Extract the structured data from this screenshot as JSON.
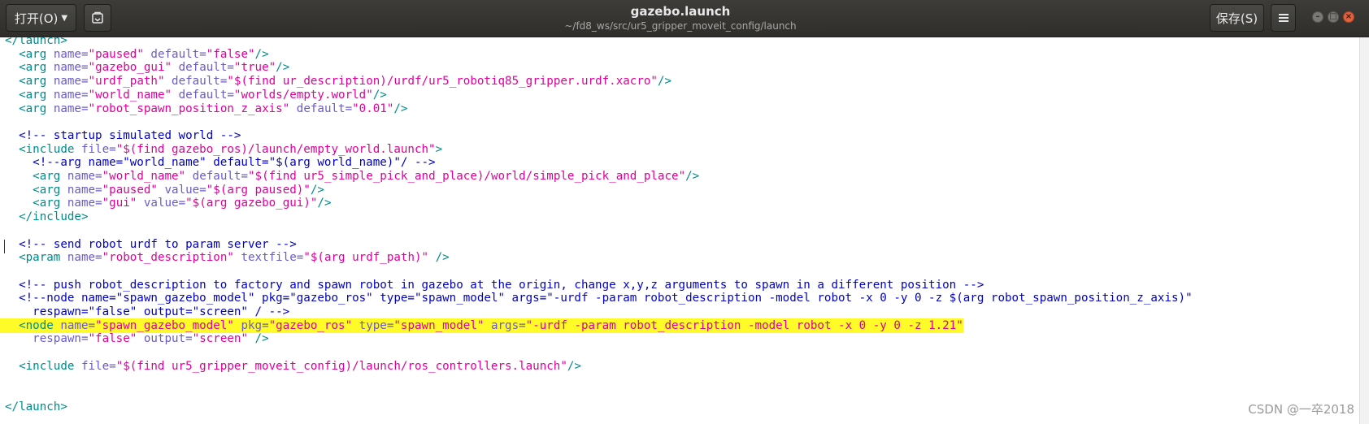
{
  "window": {
    "title": "gazebo.launch",
    "subtitle": "~/fd8_ws/src/ur5_gripper_moveit_config/launch",
    "open_label": "打开(O)",
    "save_label": "保存(S)"
  },
  "colors": {
    "tag": "#008b8b",
    "attr": "#6a5acd",
    "string": "#e0009a",
    "comment": "#0000c8",
    "highlight": "#fffb29"
  },
  "editor": {
    "lines": [
      [
        [
          "tag",
          "</launch>"
        ]
      ],
      [
        [
          "plain",
          "  "
        ],
        [
          "tag",
          "<arg "
        ],
        [
          "attr",
          "name="
        ],
        [
          "string",
          "\"paused\""
        ],
        [
          "attr",
          " default="
        ],
        [
          "string",
          "\"false\""
        ],
        [
          "tag",
          "/>"
        ]
      ],
      [
        [
          "plain",
          "  "
        ],
        [
          "tag",
          "<arg "
        ],
        [
          "attr",
          "name="
        ],
        [
          "string",
          "\"gazebo_gui\""
        ],
        [
          "attr",
          " default="
        ],
        [
          "string",
          "\"true\""
        ],
        [
          "tag",
          "/>"
        ]
      ],
      [
        [
          "plain",
          "  "
        ],
        [
          "tag",
          "<arg "
        ],
        [
          "attr",
          "name="
        ],
        [
          "string",
          "\"urdf_path\""
        ],
        [
          "attr",
          " default="
        ],
        [
          "string",
          "\"$(find ur_description)/urdf/ur5_robotiq85_gripper.urdf.xacro\""
        ],
        [
          "tag",
          "/>"
        ]
      ],
      [
        [
          "plain",
          "  "
        ],
        [
          "tag",
          "<arg "
        ],
        [
          "attr",
          "name="
        ],
        [
          "string",
          "\"world_name\""
        ],
        [
          "attr",
          " default="
        ],
        [
          "string",
          "\"worlds/empty.world\""
        ],
        [
          "tag",
          "/>"
        ]
      ],
      [
        [
          "plain",
          "  "
        ],
        [
          "tag",
          "<arg "
        ],
        [
          "attr",
          "name="
        ],
        [
          "string",
          "\"robot_spawn_position_z_axis\""
        ],
        [
          "attr",
          " default="
        ],
        [
          "string",
          "\"0.01\""
        ],
        [
          "tag",
          "/>"
        ]
      ],
      [],
      [
        [
          "plain",
          "  "
        ],
        [
          "comment",
          "<!-- startup simulated world -->"
        ]
      ],
      [
        [
          "plain",
          "  "
        ],
        [
          "tag",
          "<include "
        ],
        [
          "attr",
          "file="
        ],
        [
          "string",
          "\"$(find gazebo_ros)/launch/empty_world.launch\""
        ],
        [
          "tag",
          ">"
        ]
      ],
      [
        [
          "plain",
          "    "
        ],
        [
          "comment",
          "<!--arg name=\"world_name\" default=\"$(arg world_name)\"/ -->"
        ]
      ],
      [
        [
          "plain",
          "    "
        ],
        [
          "tag",
          "<arg "
        ],
        [
          "attr",
          "name="
        ],
        [
          "string",
          "\"world_name\""
        ],
        [
          "attr",
          " default="
        ],
        [
          "string",
          "\"$(find ur5_simple_pick_and_place)/world/simple_pick_and_place\""
        ],
        [
          "tag",
          "/>"
        ]
      ],
      [
        [
          "plain",
          "    "
        ],
        [
          "tag",
          "<arg "
        ],
        [
          "attr",
          "name="
        ],
        [
          "string",
          "\"paused\""
        ],
        [
          "attr",
          " value="
        ],
        [
          "string",
          "\"$(arg paused)\""
        ],
        [
          "tag",
          "/>"
        ]
      ],
      [
        [
          "plain",
          "    "
        ],
        [
          "tag",
          "<arg "
        ],
        [
          "attr",
          "name="
        ],
        [
          "string",
          "\"gui\""
        ],
        [
          "attr",
          " value="
        ],
        [
          "string",
          "\"$(arg gazebo_gui)\""
        ],
        [
          "tag",
          "/>"
        ]
      ],
      [
        [
          "plain",
          "  "
        ],
        [
          "tag",
          "</include>"
        ]
      ],
      [],
      [
        [
          "plain",
          "  "
        ],
        [
          "comment",
          "<!-- send robot urdf to param server -->"
        ]
      ],
      [
        [
          "plain",
          "  "
        ],
        [
          "tag",
          "<param "
        ],
        [
          "attr",
          "name="
        ],
        [
          "string",
          "\"robot_description\""
        ],
        [
          "attr",
          " textfile="
        ],
        [
          "string",
          "\"$(arg urdf_path)\""
        ],
        [
          "tag",
          " />"
        ]
      ],
      [],
      [
        [
          "plain",
          "  "
        ],
        [
          "comment",
          "<!-- push robot_description to factory and spawn robot in gazebo at the origin, change x,y,z arguments to spawn in a different position -->"
        ]
      ],
      [
        [
          "plain",
          "  "
        ],
        [
          "comment",
          "<!--node name=\"spawn_gazebo_model\" pkg=\"gazebo_ros\" type=\"spawn_model\" args=\"-urdf -param robot_description -model robot -x 0 -y 0 -z $(arg robot_spawn_position_z_axis)\""
        ]
      ],
      [
        [
          "plain",
          "    "
        ],
        [
          "comment",
          "respawn=\"false\" output=\"screen\" / -->"
        ]
      ],
      [
        [
          "plain",
          "  "
        ],
        [
          "tag",
          "<node "
        ],
        [
          "attr",
          "name="
        ],
        [
          "string",
          "\"spawn_gazebo_model\""
        ],
        [
          "attr",
          " pkg="
        ],
        [
          "string",
          "\"gazebo_ros\""
        ],
        [
          "attr",
          " type="
        ],
        [
          "string",
          "\"spawn_model\""
        ],
        [
          "attr",
          " args="
        ],
        [
          "string",
          "\"-urdf -param robot_description -model robot -x 0 -y 0 -z 1.21\""
        ]
      ],
      [
        [
          "plain",
          "    "
        ],
        [
          "attr",
          "respawn="
        ],
        [
          "string",
          "\"false\""
        ],
        [
          "attr",
          " output="
        ],
        [
          "string",
          "\"screen\""
        ],
        [
          "tag",
          " />"
        ]
      ],
      [],
      [
        [
          "plain",
          "  "
        ],
        [
          "tag",
          "<include "
        ],
        [
          "attr",
          "file="
        ],
        [
          "string",
          "\"$(find ur5_gripper_moveit_config)/launch/ros_controllers.launch\""
        ],
        [
          "tag",
          "/>"
        ]
      ],
      [],
      [],
      [
        [
          "tag",
          "</launch>"
        ]
      ]
    ],
    "highlighted_line": 21
  },
  "watermark": "CSDN @一卒2018"
}
